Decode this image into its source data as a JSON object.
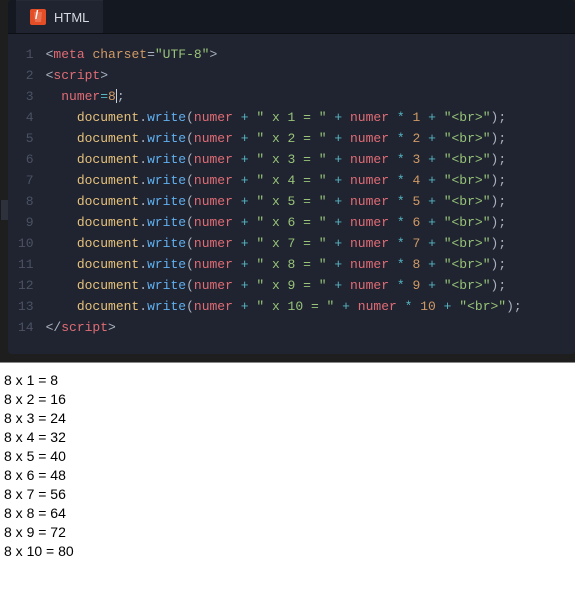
{
  "tab": {
    "label": "HTML"
  },
  "code": {
    "lineNumbers": [
      "1",
      "2",
      "3",
      "4",
      "5",
      "6",
      "7",
      "8",
      "9",
      "10",
      "11",
      "12",
      "13",
      "14"
    ],
    "lines": [
      [
        {
          "t": "<",
          "c": "punct"
        },
        {
          "t": "meta",
          "c": "tag"
        },
        {
          "t": " "
        },
        {
          "t": "charset",
          "c": "attr"
        },
        {
          "t": "=",
          "c": "punct"
        },
        {
          "t": "\"UTF-8\"",
          "c": "str"
        },
        {
          "t": ">",
          "c": "punct"
        }
      ],
      [
        {
          "t": "<",
          "c": "punct"
        },
        {
          "t": "script",
          "c": "tag"
        },
        {
          "t": ">",
          "c": "punct"
        }
      ],
      [
        {
          "t": "  "
        },
        {
          "t": "numer",
          "c": "ident"
        },
        {
          "t": "=",
          "c": "ops"
        },
        {
          "t": "8",
          "c": "num"
        },
        {
          "t": "",
          "cursor": true
        },
        {
          "t": ";",
          "c": "punct"
        }
      ],
      [
        {
          "t": "    "
        },
        {
          "t": "document",
          "c": "obj"
        },
        {
          "t": ".",
          "c": "punct"
        },
        {
          "t": "write",
          "c": "method"
        },
        {
          "t": "(",
          "c": "punct"
        },
        {
          "t": "numer",
          "c": "ident"
        },
        {
          "t": " "
        },
        {
          "t": "+",
          "c": "ops"
        },
        {
          "t": " "
        },
        {
          "t": "\" x 1 = \"",
          "c": "str"
        },
        {
          "t": " "
        },
        {
          "t": "+",
          "c": "ops"
        },
        {
          "t": " "
        },
        {
          "t": "numer",
          "c": "ident"
        },
        {
          "t": " "
        },
        {
          "t": "*",
          "c": "ops"
        },
        {
          "t": " "
        },
        {
          "t": "1",
          "c": "num"
        },
        {
          "t": " "
        },
        {
          "t": "+",
          "c": "ops"
        },
        {
          "t": " "
        },
        {
          "t": "\"<br>\"",
          "c": "str"
        },
        {
          "t": ");",
          "c": "punct"
        }
      ],
      [
        {
          "t": "    "
        },
        {
          "t": "document",
          "c": "obj"
        },
        {
          "t": ".",
          "c": "punct"
        },
        {
          "t": "write",
          "c": "method"
        },
        {
          "t": "(",
          "c": "punct"
        },
        {
          "t": "numer",
          "c": "ident"
        },
        {
          "t": " "
        },
        {
          "t": "+",
          "c": "ops"
        },
        {
          "t": " "
        },
        {
          "t": "\" x 2 = \"",
          "c": "str"
        },
        {
          "t": " "
        },
        {
          "t": "+",
          "c": "ops"
        },
        {
          "t": " "
        },
        {
          "t": "numer",
          "c": "ident"
        },
        {
          "t": " "
        },
        {
          "t": "*",
          "c": "ops"
        },
        {
          "t": " "
        },
        {
          "t": "2",
          "c": "num"
        },
        {
          "t": " "
        },
        {
          "t": "+",
          "c": "ops"
        },
        {
          "t": " "
        },
        {
          "t": "\"<br>\"",
          "c": "str"
        },
        {
          "t": ");",
          "c": "punct"
        }
      ],
      [
        {
          "t": "    "
        },
        {
          "t": "document",
          "c": "obj"
        },
        {
          "t": ".",
          "c": "punct"
        },
        {
          "t": "write",
          "c": "method"
        },
        {
          "t": "(",
          "c": "punct"
        },
        {
          "t": "numer",
          "c": "ident"
        },
        {
          "t": " "
        },
        {
          "t": "+",
          "c": "ops"
        },
        {
          "t": " "
        },
        {
          "t": "\" x 3 = \"",
          "c": "str"
        },
        {
          "t": " "
        },
        {
          "t": "+",
          "c": "ops"
        },
        {
          "t": " "
        },
        {
          "t": "numer",
          "c": "ident"
        },
        {
          "t": " "
        },
        {
          "t": "*",
          "c": "ops"
        },
        {
          "t": " "
        },
        {
          "t": "3",
          "c": "num"
        },
        {
          "t": " "
        },
        {
          "t": "+",
          "c": "ops"
        },
        {
          "t": " "
        },
        {
          "t": "\"<br>\"",
          "c": "str"
        },
        {
          "t": ");",
          "c": "punct"
        }
      ],
      [
        {
          "t": "    "
        },
        {
          "t": "document",
          "c": "obj"
        },
        {
          "t": ".",
          "c": "punct"
        },
        {
          "t": "write",
          "c": "method"
        },
        {
          "t": "(",
          "c": "punct"
        },
        {
          "t": "numer",
          "c": "ident"
        },
        {
          "t": " "
        },
        {
          "t": "+",
          "c": "ops"
        },
        {
          "t": " "
        },
        {
          "t": "\" x 4 = \"",
          "c": "str"
        },
        {
          "t": " "
        },
        {
          "t": "+",
          "c": "ops"
        },
        {
          "t": " "
        },
        {
          "t": "numer",
          "c": "ident"
        },
        {
          "t": " "
        },
        {
          "t": "*",
          "c": "ops"
        },
        {
          "t": " "
        },
        {
          "t": "4",
          "c": "num"
        },
        {
          "t": " "
        },
        {
          "t": "+",
          "c": "ops"
        },
        {
          "t": " "
        },
        {
          "t": "\"<br>\"",
          "c": "str"
        },
        {
          "t": ");",
          "c": "punct"
        }
      ],
      [
        {
          "t": "    "
        },
        {
          "t": "document",
          "c": "obj"
        },
        {
          "t": ".",
          "c": "punct"
        },
        {
          "t": "write",
          "c": "method"
        },
        {
          "t": "(",
          "c": "punct"
        },
        {
          "t": "numer",
          "c": "ident"
        },
        {
          "t": " "
        },
        {
          "t": "+",
          "c": "ops"
        },
        {
          "t": " "
        },
        {
          "t": "\" x 5 = \"",
          "c": "str"
        },
        {
          "t": " "
        },
        {
          "t": "+",
          "c": "ops"
        },
        {
          "t": " "
        },
        {
          "t": "numer",
          "c": "ident"
        },
        {
          "t": " "
        },
        {
          "t": "*",
          "c": "ops"
        },
        {
          "t": " "
        },
        {
          "t": "5",
          "c": "num"
        },
        {
          "t": " "
        },
        {
          "t": "+",
          "c": "ops"
        },
        {
          "t": " "
        },
        {
          "t": "\"<br>\"",
          "c": "str"
        },
        {
          "t": ");",
          "c": "punct"
        }
      ],
      [
        {
          "t": "    "
        },
        {
          "t": "document",
          "c": "obj"
        },
        {
          "t": ".",
          "c": "punct"
        },
        {
          "t": "write",
          "c": "method"
        },
        {
          "t": "(",
          "c": "punct"
        },
        {
          "t": "numer",
          "c": "ident"
        },
        {
          "t": " "
        },
        {
          "t": "+",
          "c": "ops"
        },
        {
          "t": " "
        },
        {
          "t": "\" x 6 = \"",
          "c": "str"
        },
        {
          "t": " "
        },
        {
          "t": "+",
          "c": "ops"
        },
        {
          "t": " "
        },
        {
          "t": "numer",
          "c": "ident"
        },
        {
          "t": " "
        },
        {
          "t": "*",
          "c": "ops"
        },
        {
          "t": " "
        },
        {
          "t": "6",
          "c": "num"
        },
        {
          "t": " "
        },
        {
          "t": "+",
          "c": "ops"
        },
        {
          "t": " "
        },
        {
          "t": "\"<br>\"",
          "c": "str"
        },
        {
          "t": ");",
          "c": "punct"
        }
      ],
      [
        {
          "t": "    "
        },
        {
          "t": "document",
          "c": "obj"
        },
        {
          "t": ".",
          "c": "punct"
        },
        {
          "t": "write",
          "c": "method"
        },
        {
          "t": "(",
          "c": "punct"
        },
        {
          "t": "numer",
          "c": "ident"
        },
        {
          "t": " "
        },
        {
          "t": "+",
          "c": "ops"
        },
        {
          "t": " "
        },
        {
          "t": "\" x 7 = \"",
          "c": "str"
        },
        {
          "t": " "
        },
        {
          "t": "+",
          "c": "ops"
        },
        {
          "t": " "
        },
        {
          "t": "numer",
          "c": "ident"
        },
        {
          "t": " "
        },
        {
          "t": "*",
          "c": "ops"
        },
        {
          "t": " "
        },
        {
          "t": "7",
          "c": "num"
        },
        {
          "t": " "
        },
        {
          "t": "+",
          "c": "ops"
        },
        {
          "t": " "
        },
        {
          "t": "\"<br>\"",
          "c": "str"
        },
        {
          "t": ");",
          "c": "punct"
        }
      ],
      [
        {
          "t": "    "
        },
        {
          "t": "document",
          "c": "obj"
        },
        {
          "t": ".",
          "c": "punct"
        },
        {
          "t": "write",
          "c": "method"
        },
        {
          "t": "(",
          "c": "punct"
        },
        {
          "t": "numer",
          "c": "ident"
        },
        {
          "t": " "
        },
        {
          "t": "+",
          "c": "ops"
        },
        {
          "t": " "
        },
        {
          "t": "\" x 8 = \"",
          "c": "str"
        },
        {
          "t": " "
        },
        {
          "t": "+",
          "c": "ops"
        },
        {
          "t": " "
        },
        {
          "t": "numer",
          "c": "ident"
        },
        {
          "t": " "
        },
        {
          "t": "*",
          "c": "ops"
        },
        {
          "t": " "
        },
        {
          "t": "8",
          "c": "num"
        },
        {
          "t": " "
        },
        {
          "t": "+",
          "c": "ops"
        },
        {
          "t": " "
        },
        {
          "t": "\"<br>\"",
          "c": "str"
        },
        {
          "t": ");",
          "c": "punct"
        }
      ],
      [
        {
          "t": "    "
        },
        {
          "t": "document",
          "c": "obj"
        },
        {
          "t": ".",
          "c": "punct"
        },
        {
          "t": "write",
          "c": "method"
        },
        {
          "t": "(",
          "c": "punct"
        },
        {
          "t": "numer",
          "c": "ident"
        },
        {
          "t": " "
        },
        {
          "t": "+",
          "c": "ops"
        },
        {
          "t": " "
        },
        {
          "t": "\" x 9 = \"",
          "c": "str"
        },
        {
          "t": " "
        },
        {
          "t": "+",
          "c": "ops"
        },
        {
          "t": " "
        },
        {
          "t": "numer",
          "c": "ident"
        },
        {
          "t": " "
        },
        {
          "t": "*",
          "c": "ops"
        },
        {
          "t": " "
        },
        {
          "t": "9",
          "c": "num"
        },
        {
          "t": " "
        },
        {
          "t": "+",
          "c": "ops"
        },
        {
          "t": " "
        },
        {
          "t": "\"<br>\"",
          "c": "str"
        },
        {
          "t": ");",
          "c": "punct"
        }
      ],
      [
        {
          "t": "    "
        },
        {
          "t": "document",
          "c": "obj"
        },
        {
          "t": ".",
          "c": "punct"
        },
        {
          "t": "write",
          "c": "method"
        },
        {
          "t": "(",
          "c": "punct"
        },
        {
          "t": "numer",
          "c": "ident"
        },
        {
          "t": " "
        },
        {
          "t": "+",
          "c": "ops"
        },
        {
          "t": " "
        },
        {
          "t": "\" x 10 = \"",
          "c": "str"
        },
        {
          "t": " "
        },
        {
          "t": "+",
          "c": "ops"
        },
        {
          "t": " "
        },
        {
          "t": "numer",
          "c": "ident"
        },
        {
          "t": " "
        },
        {
          "t": "*",
          "c": "ops"
        },
        {
          "t": " "
        },
        {
          "t": "10",
          "c": "num"
        },
        {
          "t": " "
        },
        {
          "t": "+",
          "c": "ops"
        },
        {
          "t": " "
        },
        {
          "t": "\"<br>\"",
          "c": "str"
        },
        {
          "t": ");",
          "c": "punct"
        }
      ],
      [
        {
          "t": "</",
          "c": "punct"
        },
        {
          "t": "script",
          "c": "tag"
        },
        {
          "t": ">",
          "c": "punct"
        }
      ]
    ]
  },
  "output": [
    "8 x 1 = 8",
    "8 x 2 = 16",
    "8 x 3 = 24",
    "8 x 4 = 32",
    "8 x 5 = 40",
    "8 x 6 = 48",
    "8 x 7 = 56",
    "8 x 8 = 64",
    "8 x 9 = 72",
    "8 x 10 = 80"
  ]
}
